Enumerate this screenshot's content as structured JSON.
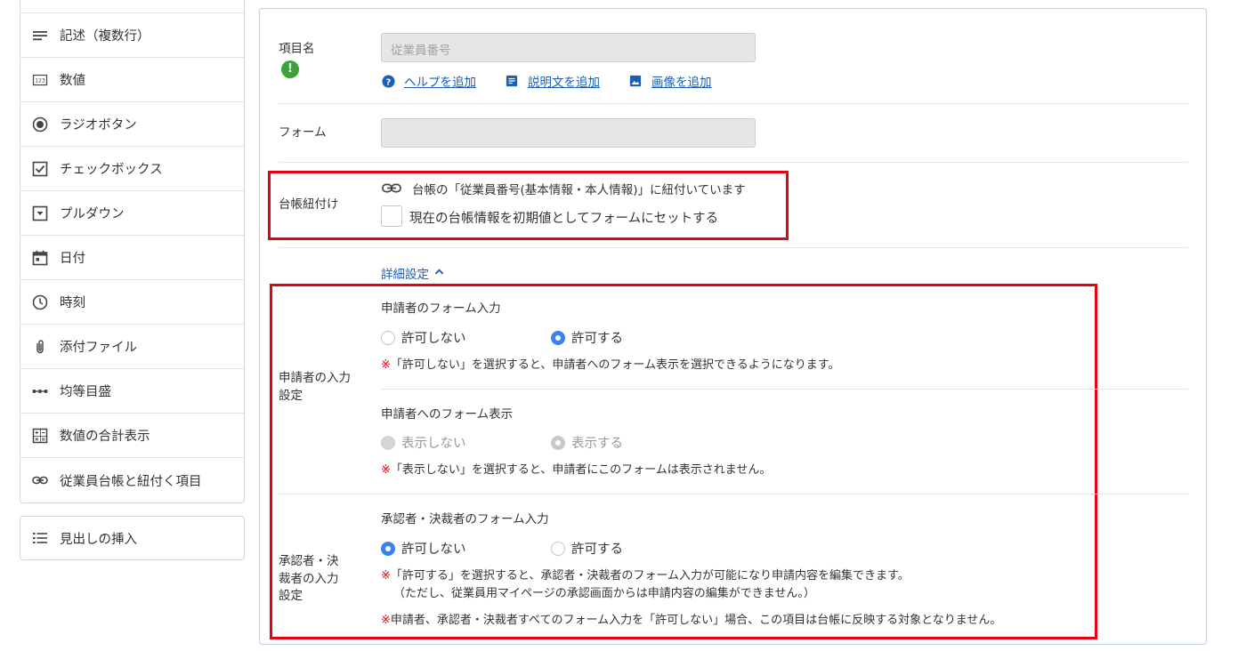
{
  "sidebar": {
    "items": [
      {
        "label": "記述（複数行）",
        "icon": "multiline-text-icon"
      },
      {
        "label": "数値",
        "icon": "number-icon"
      },
      {
        "label": "ラジオボタン",
        "icon": "radio-icon"
      },
      {
        "label": "チェックボックス",
        "icon": "checkbox-icon"
      },
      {
        "label": "プルダウン",
        "icon": "dropdown-icon"
      },
      {
        "label": "日付",
        "icon": "calendar-icon"
      },
      {
        "label": "時刻",
        "icon": "clock-icon"
      },
      {
        "label": "添付ファイル",
        "icon": "paperclip-icon"
      },
      {
        "label": "均等目盛",
        "icon": "scale-dots-icon"
      },
      {
        "label": "数値の合計表示",
        "icon": "calculator-icon"
      },
      {
        "label": "従業員台帳と紐付く項目",
        "icon": "link-icon"
      }
    ],
    "heading_insert": "見出しの挿入"
  },
  "item_name": {
    "label": "項目名",
    "value": "従業員番号",
    "links": [
      "ヘルプを追加",
      "説明文を追加",
      "画像を追加"
    ]
  },
  "form": {
    "label": "フォーム",
    "value": ""
  },
  "ledger": {
    "label": "台帳紐付け",
    "linked_text": "台帳の「従業員番号(基本情報・本人情報)」に紐付いています",
    "checkbox_label": "現在の台帳情報を初期値としてフォームにセットする"
  },
  "detail_toggle": "詳細設定",
  "applicant": {
    "label": "申請者の入力設定",
    "input_title": "申請者のフォーム入力",
    "input_options": [
      "許可しない",
      "許可する"
    ],
    "input_note_mark": "※",
    "input_note": "「許可しない」を選択すると、申請者へのフォーム表示を選択できるようになります。",
    "display_title": "申請者へのフォーム表示",
    "display_options": [
      "表示しない",
      "表示する"
    ],
    "display_note_mark": "※",
    "display_note": "「表示しない」を選択すると、申請者にこのフォームは表示されません。"
  },
  "approver": {
    "label": "承認者・決裁者の入力設定",
    "input_title": "承認者・決裁者のフォーム入力",
    "input_options": [
      "許可しない",
      "許可する"
    ],
    "note1_mark": "※",
    "note1_line1": "「許可する」を選択すると、承認者・決裁者のフォーム入力が可能になり申請内容を編集できます。",
    "note1_line2": "（ただし、従業員用マイページの承認画面からは申請内容の編集ができません。）",
    "note2_mark": "※",
    "note2": "申請者、承認者・決裁者すべてのフォーム入力を「許可しない」場合、この項目は台帳に反映する対象となりません。"
  },
  "colors": {
    "accent": "#1a5fb4",
    "radio_on": "#3b82f0",
    "highlight": "#e60012",
    "badge": "#3aa33a"
  }
}
